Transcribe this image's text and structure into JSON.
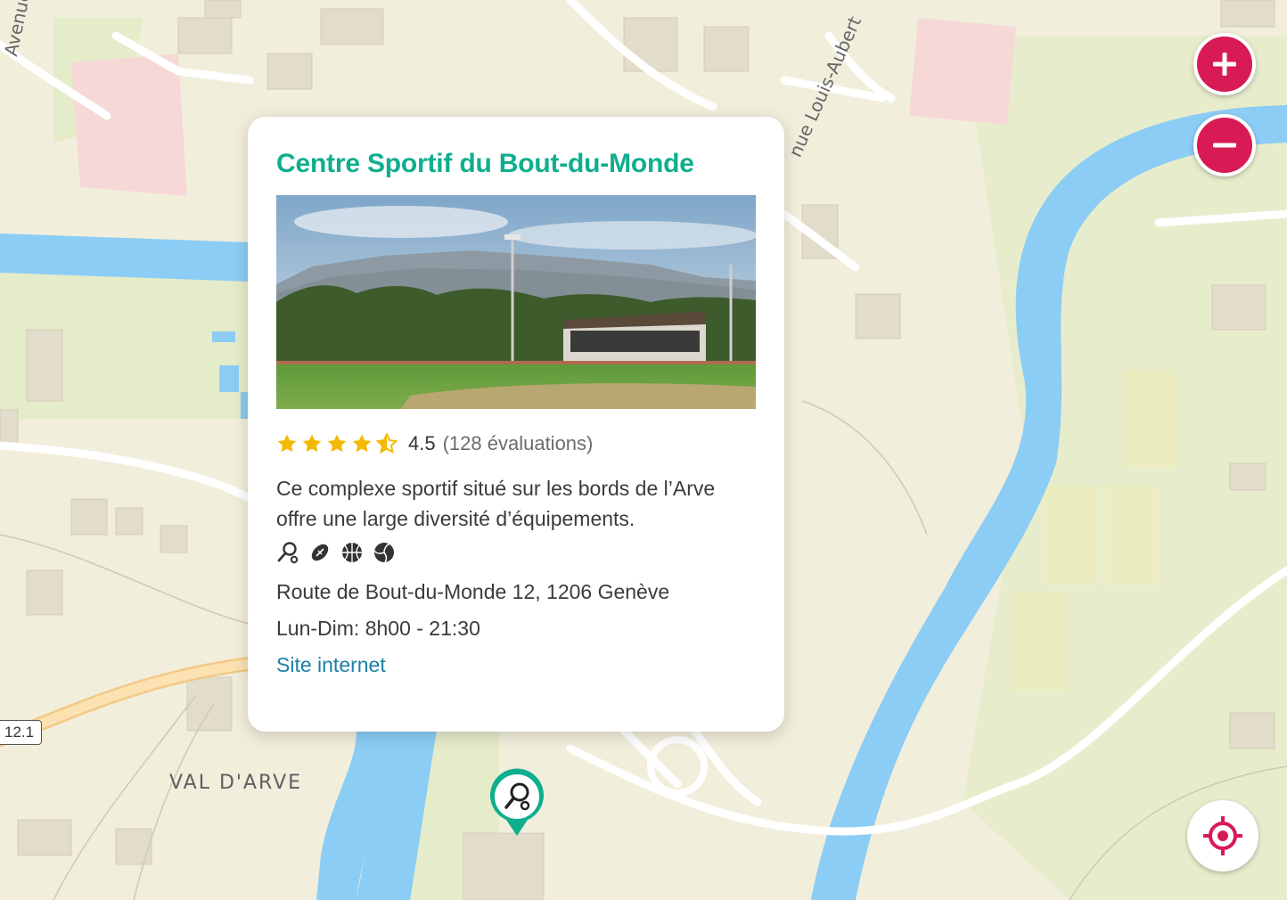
{
  "map": {
    "place_label": "VAL D'ARVE",
    "street_labels": [
      "Avenue de la",
      "nue Louis-Aubert"
    ],
    "road_number": "12.1"
  },
  "controls": {
    "zoom_in_icon": "plus-icon",
    "zoom_out_icon": "minus-icon",
    "locate_icon": "crosshair-icon"
  },
  "popup": {
    "title": "Centre Sportif du Bout-du-Monde",
    "rating": {
      "stars": 4.5,
      "value": "4.5",
      "count": "(128 évaluations)"
    },
    "description": "Ce complexe sportif situé sur les bords de l’Arve offre une large diversité d’équipements.",
    "sport_icons": [
      "table-tennis-icon",
      "rugby-ball-icon",
      "basketball-icon",
      "volleyball-icon"
    ],
    "address": "Route de Bout-du-Monde 12, 1206 Genève",
    "hours": "Lun-Dim: 8h00 - 21:30",
    "website_label": "Site internet"
  },
  "marker": {
    "icon": "table-tennis-icon"
  },
  "colors": {
    "accent_pink": "#d81b55",
    "title_green": "#0fae8e",
    "link_blue": "#1d7fa6",
    "river": "#8ccdf5",
    "star": "#f5b800"
  }
}
